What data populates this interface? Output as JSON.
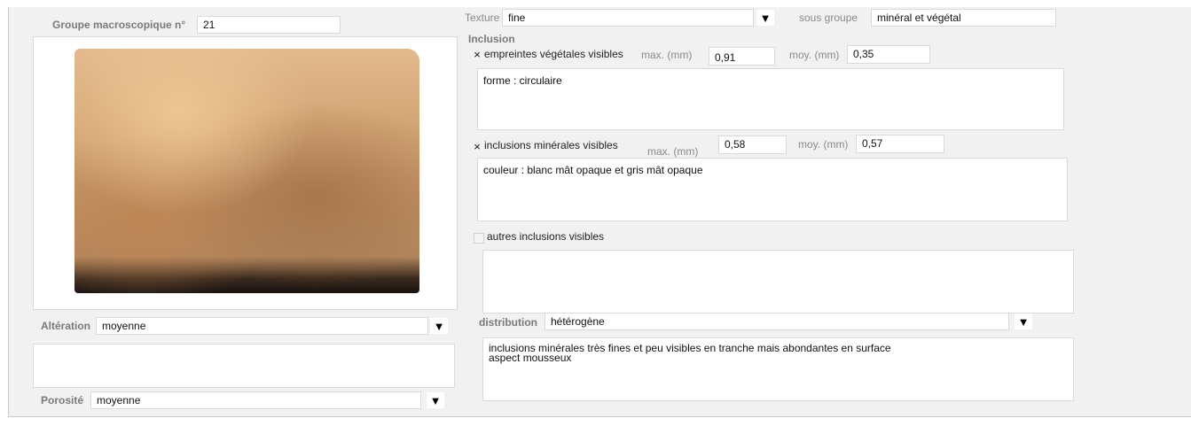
{
  "groupe": {
    "label": "Groupe macroscopique n°",
    "value": "21"
  },
  "texture": {
    "label": "Texture",
    "value": "fine"
  },
  "sous_groupe": {
    "label": "sous groupe",
    "value": "minéral et végétal"
  },
  "inclusion": {
    "title": "Inclusion",
    "vegetales": {
      "checked": true,
      "check_mark": "×",
      "label": "empreintes végétales visibles",
      "max_label": "max. (mm)",
      "max_value": "0,91",
      "moy_label": "moy. (mm)",
      "moy_value": "0,35",
      "note": "forme : circulaire"
    },
    "minerales": {
      "checked": true,
      "check_mark": "×",
      "label": "inclusions minérales visibles",
      "max_label": "max. (mm)",
      "max_value": "0,58",
      "moy_label": "moy. (mm)",
      "moy_value": "0,57",
      "note": "couleur : blanc mât opaque et gris mât opaque"
    },
    "autres": {
      "checked": false,
      "label": "autres inclusions visibles",
      "note": ""
    }
  },
  "distribution": {
    "label": "distribution",
    "value": "hétérogène",
    "note": "inclusions minérales très fines et peu visibles en tranche mais abondantes en surface\naspect mousseux"
  },
  "alteration": {
    "label": "Altération",
    "value": "moyenne",
    "note": ""
  },
  "porosite": {
    "label": "Porosité",
    "value": "moyenne"
  },
  "dropdown_arrow": "▼"
}
